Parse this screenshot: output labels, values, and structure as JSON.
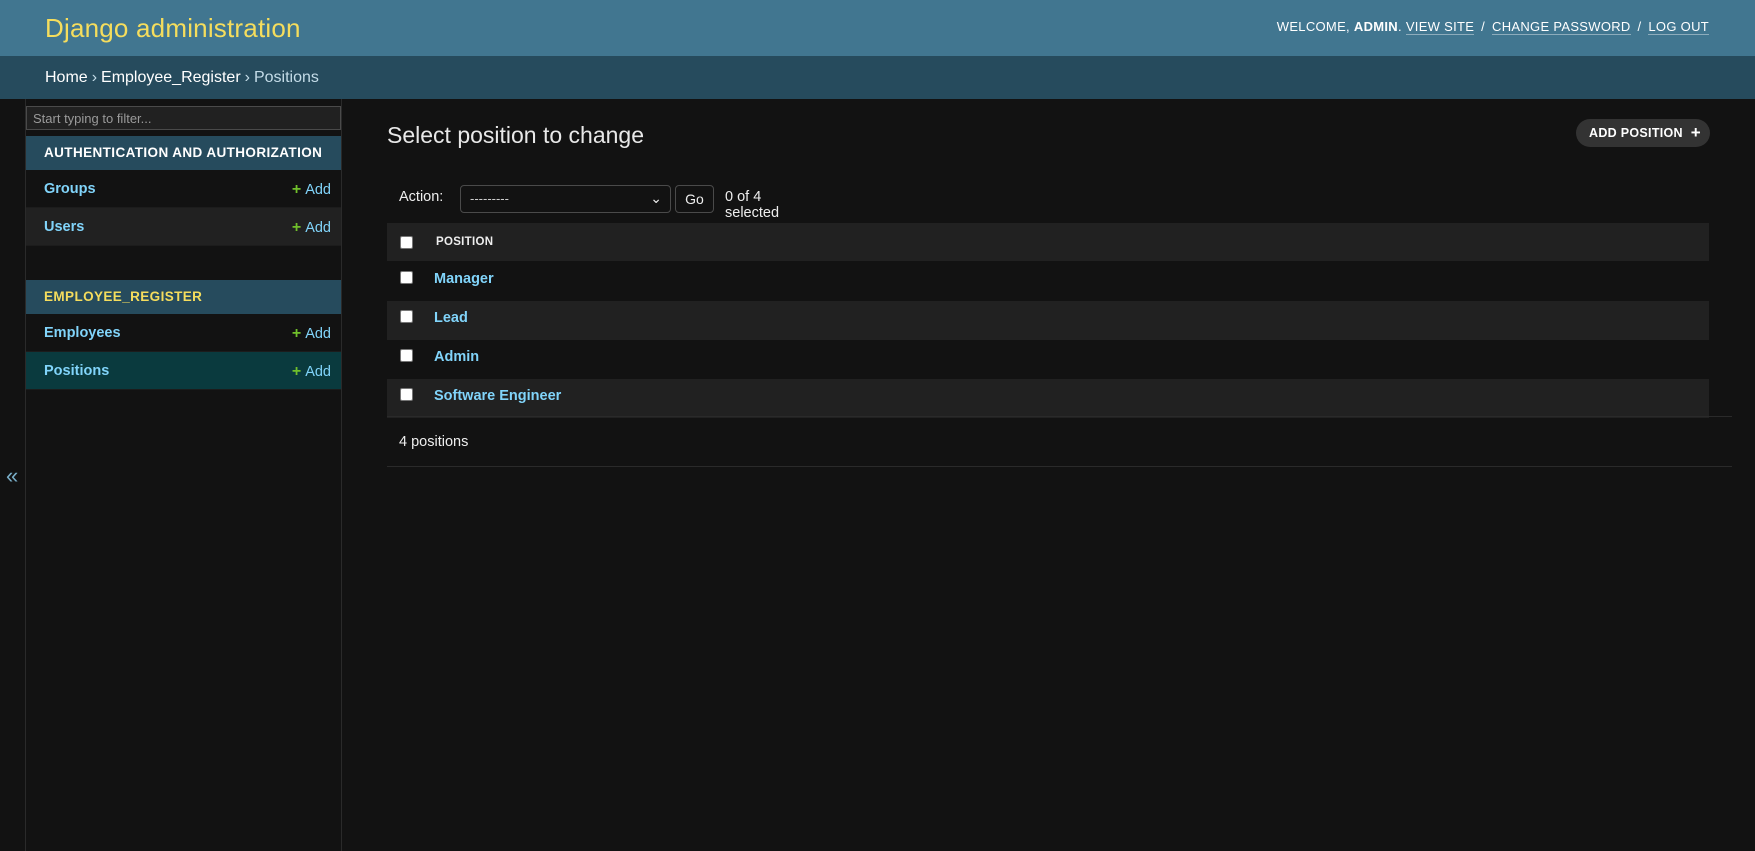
{
  "header": {
    "branding": "Django administration",
    "welcome_prefix": "WELCOME,",
    "username": "ADMIN",
    "view_site": "VIEW SITE",
    "change_password": "CHANGE PASSWORD",
    "log_out": "LOG OUT",
    "separator": "/"
  },
  "breadcrumbs": {
    "home": "Home",
    "app": "Employee_Register",
    "current": "Positions",
    "arrow": "›"
  },
  "sidebar": {
    "toggle_icon": "«",
    "filter_placeholder": "Start typing to filter...",
    "modules": [
      {
        "caption": "AUTHENTICATION AND AUTHORIZATION",
        "models": [
          {
            "name": "Groups",
            "add": "Add"
          },
          {
            "name": "Users",
            "add": "Add"
          }
        ]
      },
      {
        "caption": "EMPLOYEE_REGISTER",
        "models": [
          {
            "name": "Employees",
            "add": "Add"
          },
          {
            "name": "Positions",
            "add": "Add",
            "current": true
          }
        ]
      }
    ]
  },
  "content": {
    "title": "Select position to change",
    "add_button": "ADD POSITION",
    "add_icon": "+",
    "action_label": "Action:",
    "action_selected": "---------",
    "go_button": "Go",
    "selected_count": "0 of 4 selected",
    "column_header": "POSITION",
    "rows": [
      "Manager",
      "Lead",
      "Admin",
      "Software Engineer"
    ],
    "paginator": "4 positions"
  },
  "colors": {
    "header_bg": "#417690",
    "breadcrumbs_bg": "#264b5d",
    "branding": "#f5dd5d",
    "link": "#81d4fa",
    "add_plus": "#70bf2b",
    "current_row": "#0a3a3e"
  }
}
